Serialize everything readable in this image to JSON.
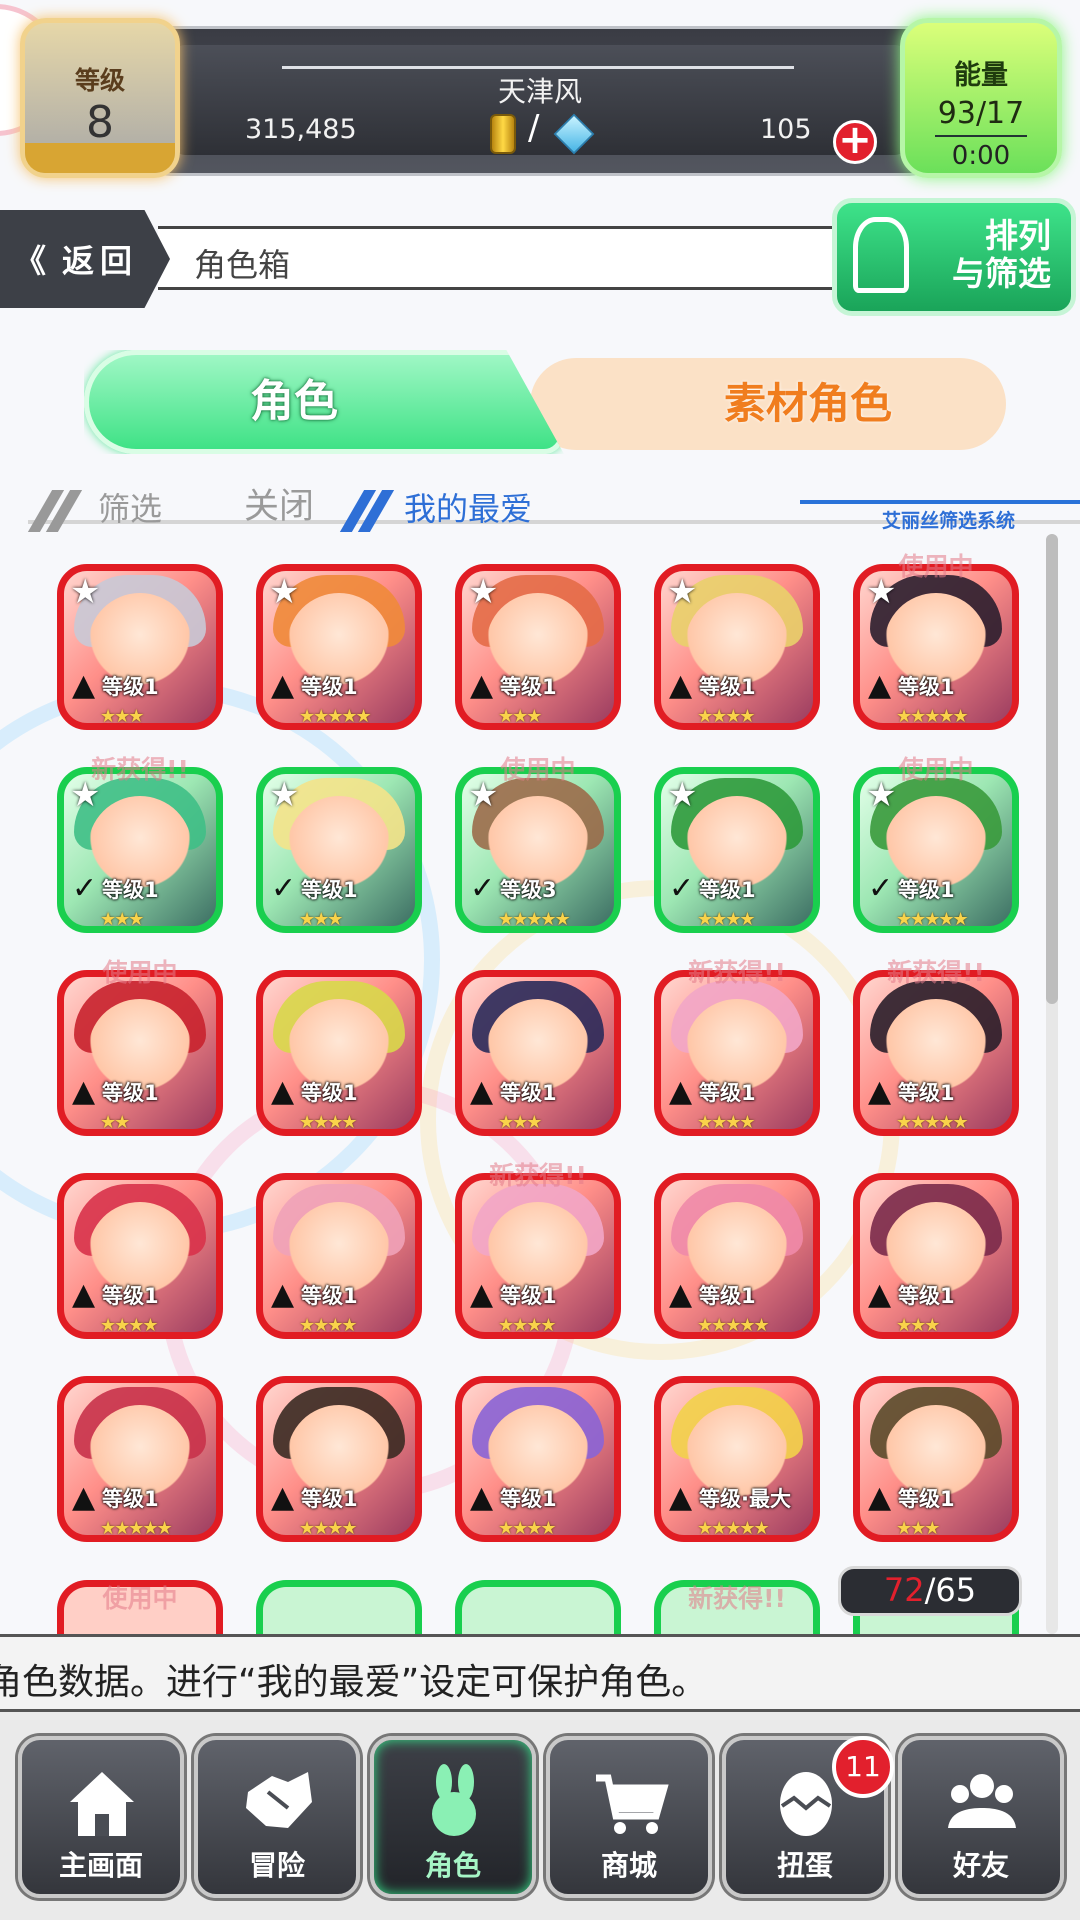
{
  "header": {
    "level_label": "等级",
    "level_value": "8",
    "player_name": "天津风",
    "gold": "315,485",
    "gems": "105",
    "currency_separator": "/",
    "energy_label": "能量",
    "energy_value": "93/17",
    "energy_timer": "0:00"
  },
  "nav": {
    "back_label": "返回",
    "page_title": "角色箱",
    "sort_label_line1": "排列",
    "sort_label_line2": "与筛选"
  },
  "tabs": {
    "characters": "角色",
    "materials": "素材角色"
  },
  "filter": {
    "filter_label": "筛选",
    "filter_state": "关闭",
    "favorites_label": "我的最爱",
    "system_note": "艾丽丝筛选系统"
  },
  "grid": {
    "rows": [
      [
        {
          "color": "red",
          "star": true,
          "tag": "",
          "level": "等级1",
          "rarity": "★★★"
        },
        {
          "color": "red",
          "star": true,
          "tag": "",
          "level": "等级1",
          "rarity": "★★★★★"
        },
        {
          "color": "red",
          "star": true,
          "tag": "",
          "level": "等级1",
          "rarity": "★★★"
        },
        {
          "color": "red",
          "star": true,
          "tag": "",
          "level": "等级1",
          "rarity": "★★★★"
        },
        {
          "color": "red",
          "star": true,
          "tag": "使用中",
          "level": "等级1",
          "rarity": "★★★★★"
        }
      ],
      [
        {
          "color": "green",
          "star": true,
          "tag": "新获得!!",
          "level": "等级1",
          "rarity": "★★★"
        },
        {
          "color": "green",
          "star": true,
          "tag": "",
          "level": "等级1",
          "rarity": "★★★"
        },
        {
          "color": "green",
          "star": true,
          "tag": "使用中",
          "level": "等级3",
          "rarity": "★★★★★"
        },
        {
          "color": "green",
          "star": true,
          "tag": "",
          "level": "等级1",
          "rarity": "★★★★"
        },
        {
          "color": "green",
          "star": true,
          "tag": "使用中",
          "level": "等级1",
          "rarity": "★★★★★"
        }
      ],
      [
        {
          "color": "red",
          "star": false,
          "tag": "使用中",
          "level": "等级1",
          "rarity": "★★"
        },
        {
          "color": "red",
          "star": false,
          "tag": "",
          "level": "等级1",
          "rarity": "★★★★"
        },
        {
          "color": "red",
          "star": false,
          "tag": "",
          "level": "等级1",
          "rarity": "★★★"
        },
        {
          "color": "red",
          "star": false,
          "tag": "新获得!!",
          "level": "等级1",
          "rarity": "★★★★"
        },
        {
          "color": "red",
          "star": false,
          "tag": "新获得!!",
          "level": "等级1",
          "rarity": "★★★★★"
        }
      ],
      [
        {
          "color": "red",
          "star": false,
          "tag": "",
          "level": "等级1",
          "rarity": "★★★★"
        },
        {
          "color": "red",
          "star": false,
          "tag": "",
          "level": "等级1",
          "rarity": "★★★★"
        },
        {
          "color": "red",
          "star": false,
          "tag": "新获得!!",
          "level": "等级1",
          "rarity": "★★★★"
        },
        {
          "color": "red",
          "star": false,
          "tag": "",
          "level": "等级1",
          "rarity": "★★★★★"
        },
        {
          "color": "red",
          "star": false,
          "tag": "",
          "level": "等级1",
          "rarity": "★★★"
        }
      ],
      [
        {
          "color": "red",
          "star": false,
          "tag": "",
          "level": "等级1",
          "rarity": "★★★★★"
        },
        {
          "color": "red",
          "star": false,
          "tag": "",
          "level": "等级1",
          "rarity": "★★★★"
        },
        {
          "color": "red",
          "star": false,
          "tag": "",
          "level": "等级1",
          "rarity": "★★★★"
        },
        {
          "color": "red",
          "star": false,
          "tag": "",
          "level": "等级·最大",
          "rarity": "★★★★★"
        },
        {
          "color": "red",
          "star": false,
          "tag": "",
          "level": "等级1",
          "rarity": "★★★"
        }
      ]
    ],
    "partial_row": [
      {
        "color": "red",
        "tag": "使用中"
      },
      {
        "color": "green",
        "tag": ""
      },
      {
        "color": "green",
        "tag": ""
      },
      {
        "color": "green",
        "tag": "新获得!!"
      },
      {
        "color": "green",
        "tag": ""
      }
    ],
    "count_current": "72",
    "count_separator": "/",
    "count_max": "65"
  },
  "ticker": {
    "text": "角色数据。进行“我的最爱”设定可保护角色。"
  },
  "bottom_nav": {
    "items": [
      {
        "label": "主画面",
        "icon": "home-icon"
      },
      {
        "label": "冒险",
        "icon": "handshake-icon"
      },
      {
        "label": "角色",
        "icon": "bunny-icon"
      },
      {
        "label": "商城",
        "icon": "cart-icon"
      },
      {
        "label": "扭蛋",
        "icon": "egg-icon"
      },
      {
        "label": "好友",
        "icon": "friends-icon"
      }
    ],
    "gacha_badge": "11"
  },
  "colors": {
    "accent_green": "#3fe286",
    "accent_orange": "#f07d1e",
    "card_red": "#e11c23",
    "card_green": "#19cf4e",
    "badge_red": "#e2202d",
    "link_blue": "#2e6fd6"
  }
}
